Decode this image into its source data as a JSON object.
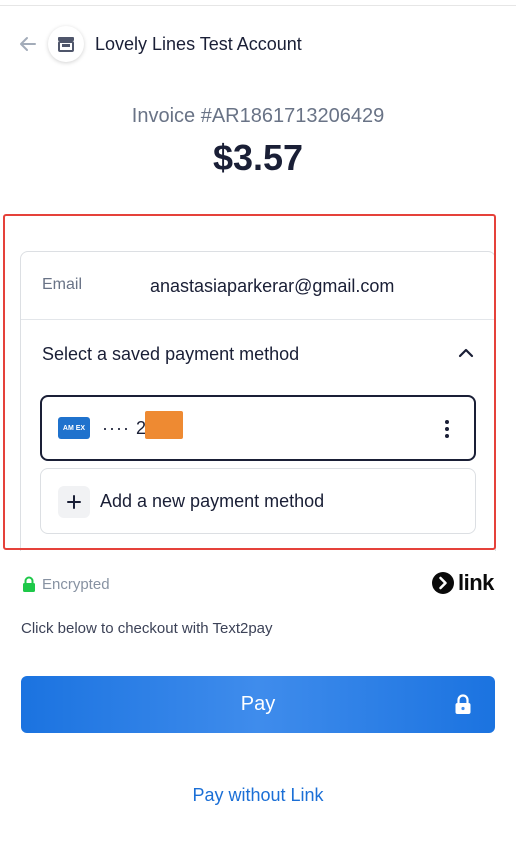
{
  "header": {
    "merchant_name": "Lovely Lines Test Account",
    "back_icon": "arrow-left-icon",
    "merchant_icon": "store-icon"
  },
  "invoice": {
    "label": "Invoice #AR1861713206429",
    "amount": "$3.57"
  },
  "form": {
    "email_label": "Email",
    "email_value": "anastasiaparkerar@gmail.com",
    "saved_methods_title": "Select a saved payment method",
    "saved_card": {
      "brand_icon": "amex-card-icon",
      "brand_text": "AM EX",
      "masked_number": "···· 2"
    },
    "add_method_label": "Add a new payment method"
  },
  "security": {
    "encrypted_label": "Encrypted",
    "link_brand": "link"
  },
  "checkout": {
    "note": "Click below to checkout with Text2pay",
    "pay_label": "Pay",
    "pay_without_link": "Pay without Link"
  },
  "colors": {
    "accent_blue": "#1b73e0",
    "highlight_red": "#e5413a",
    "encrypted_green": "#1ec849",
    "redaction_orange": "#ee8a32"
  }
}
